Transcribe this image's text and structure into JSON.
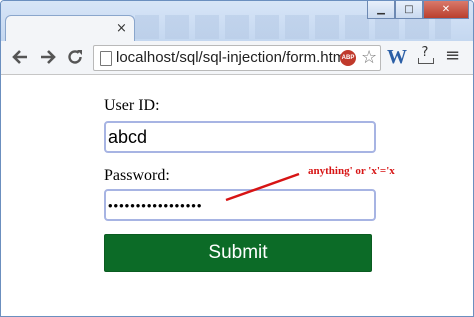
{
  "browser": {
    "tab_close_glyph": "×",
    "window_buttons": {
      "minimize": "▁",
      "maximize": "□",
      "close": "✕"
    },
    "nav": {
      "back_icon": "arrow-left-icon",
      "forward_icon": "arrow-right-icon",
      "reload_icon": "reload-icon"
    },
    "url": "localhost/sql/sql-injection/form.html",
    "extensions": {
      "adblock_label": "ABP",
      "w_label": "W",
      "help_label": "?"
    }
  },
  "form": {
    "user_id_label": "User ID:",
    "user_id_value": "abcd",
    "password_label": "Password:",
    "password_mask": "•••••••••••••••••",
    "submit_label": "Submit"
  },
  "annotation": {
    "text": "anything' or 'x'='x",
    "color": "#d71414"
  },
  "colors": {
    "submit_bg": "#0c6b27",
    "field_border": "#a7b4e3"
  }
}
